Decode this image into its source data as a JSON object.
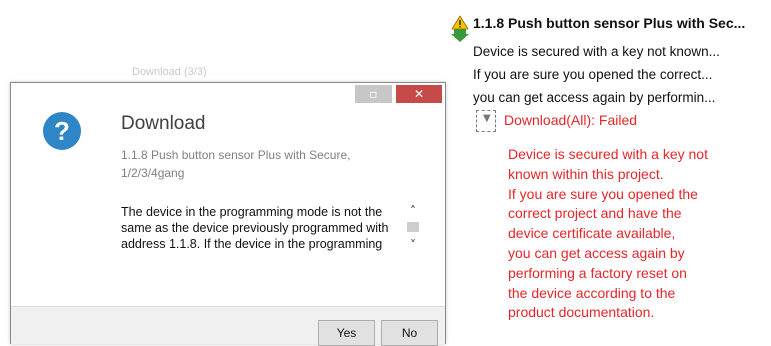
{
  "background_label": "Download (3/3)",
  "dialog": {
    "window_buttons": {
      "minimize": "▫",
      "close": "✕"
    },
    "icon_glyph": "?",
    "title": "Download",
    "subtitle": "1.1.8 Push button sensor Plus with Secure, 1/2/3/4gang",
    "body": "The device in the programming mode is not the same as the device previously programmed with address 1.1.8. If the device in the programming mode is not the right one, please cancel.",
    "scroll": {
      "up": "˄",
      "down": "˅"
    },
    "buttons": {
      "yes": "Yes",
      "no": "No"
    }
  },
  "error_panel": {
    "title": "1.1.8 Push button sensor Plus with Sec...",
    "lines": [
      "Device is secured with a key not known...",
      "If you are sure you opened the correct...",
      "you can get access again by performin..."
    ],
    "expander_glyph": "▼",
    "download_status": "Download(All): Failed",
    "detail_lines": [
      "Device is secured with a key not",
      "known within this project.",
      "If you are sure you opened the",
      "correct project and have the",
      "device certificate available,",
      "you can get access again by",
      "performing a factory reset on",
      "the device according to the",
      "product documentation."
    ]
  },
  "colors": {
    "error_red": "#e5262a",
    "question_blue": "#2e86c6",
    "close_red": "#c74a4a",
    "warning_yellow": "#f5c400",
    "arrow_green": "#3a9a3a"
  },
  "icons": {
    "question": "question-icon",
    "error": "warning-download-icon",
    "expander": "chevron-down-icon"
  }
}
